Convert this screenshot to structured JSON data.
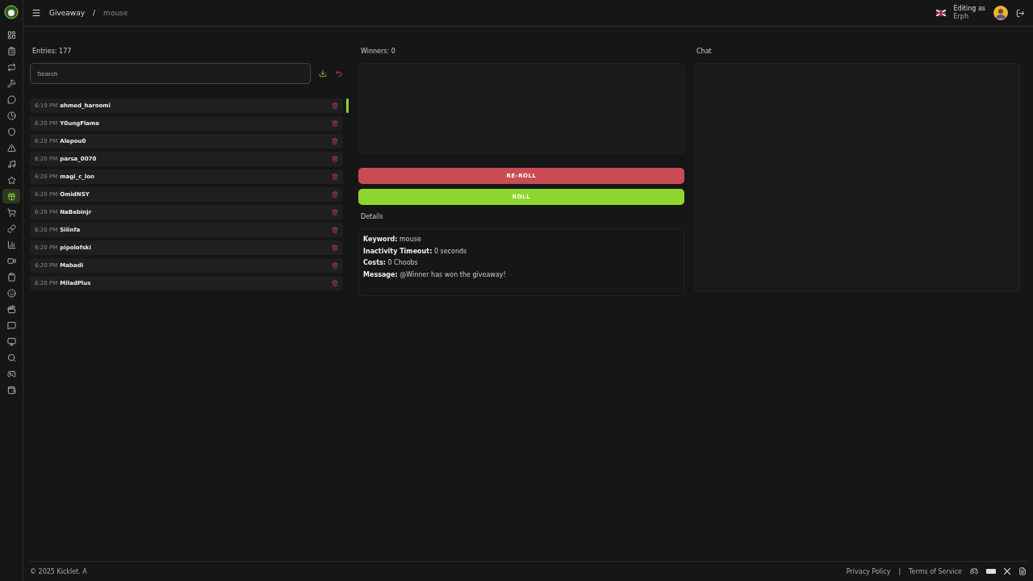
{
  "sidebar": {
    "items": [
      {
        "selected": false
      },
      {
        "selected": false
      },
      {
        "selected": false
      },
      {
        "selected": false
      },
      {
        "selected": false
      },
      {
        "selected": false
      },
      {
        "selected": false
      },
      {
        "selected": false
      },
      {
        "selected": false
      },
      {
        "selected": false
      },
      {
        "selected": true
      },
      {
        "selected": false
      },
      {
        "selected": false
      },
      {
        "selected": false
      },
      {
        "selected": false
      },
      {
        "selected": false
      },
      {
        "selected": false
      },
      {
        "selected": false
      },
      {
        "selected": false
      },
      {
        "selected": false
      },
      {
        "selected": false
      },
      {
        "selected": false
      },
      {
        "selected": false
      }
    ]
  },
  "header": {
    "breadcrumb": [
      "Giveaway",
      "mouse"
    ],
    "separator": "/",
    "user_label": "Editing as",
    "user_name": "Erph"
  },
  "entries": {
    "title": "Entries: 177",
    "search": {
      "placeholder": "Search"
    },
    "rows": [
      {
        "time": "6:19 PM",
        "name": "ahmed_haroomi"
      },
      {
        "time": "6:20 PM",
        "name": "Y0ungFlame"
      },
      {
        "time": "6:20 PM",
        "name": "Alepou0"
      },
      {
        "time": "6:20 PM",
        "name": "parsa_0070"
      },
      {
        "time": "6:20 PM",
        "name": "magi_c_lon"
      },
      {
        "time": "6:20 PM",
        "name": "OmidNSY"
      },
      {
        "time": "6:20 PM",
        "name": "NaBebinjr"
      },
      {
        "time": "6:20 PM",
        "name": "Siiinfa"
      },
      {
        "time": "6:20 PM",
        "name": "pipolofski"
      },
      {
        "time": "6:20 PM",
        "name": "Mabadi"
      },
      {
        "time": "6:20 PM",
        "name": "MiladPlus"
      }
    ]
  },
  "winners": {
    "title": "Winners: 0"
  },
  "buttons": [
    {
      "label": "RE-ROLL",
      "kind": "danger"
    },
    {
      "label": "ROLL",
      "kind": "primary"
    }
  ],
  "details": {
    "title": "Details",
    "lines": [
      "**Keyword:** mouse",
      "**Inactivity Timeout:** 0 seconds",
      "**Costs:** 0 Choobs",
      "**Message:** @Winner has won the giveaway!"
    ]
  },
  "chat": {
    "title": "Chat"
  },
  "footer": {
    "copyright": "© 2025 Kicklet. A",
    "links": [
      "Privacy Policy",
      "Terms of Service"
    ],
    "separator": "|"
  }
}
